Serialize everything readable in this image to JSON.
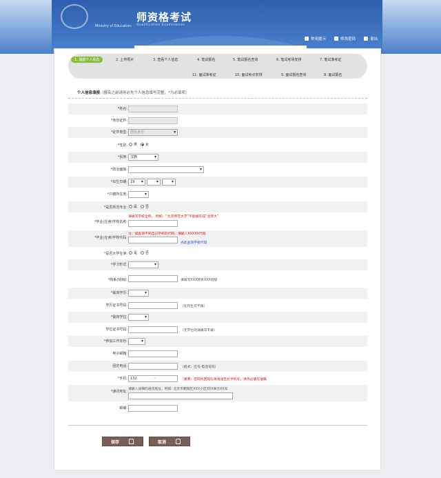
{
  "header": {
    "logo_sub": "Ministry of Education",
    "title": "师资格考试",
    "subtitle": "Qualification Examination",
    "links": [
      "常用提示",
      "修改密码",
      "退出"
    ]
  },
  "steps": [
    "1. 填报个人信息",
    "2. 上传照片",
    "3. 查看个人信息",
    "4. 笔试报名",
    "5. 笔试报名查询",
    "6. 笔试考场安排",
    "7. 笔试准考证",
    "11. 面试准考证",
    "10. 面试考点安排",
    "9. 面试报名查询",
    "8. 面试报名"
  ],
  "section": {
    "title": "个人信息填报",
    "hint": "（报名之前请务必先个人信息填写完整，*为必填项）"
  },
  "form": {
    "name_label": "*姓名:",
    "idno_label": "*身份证件:",
    "idtype_label": "*证件类型:",
    "idtype_value": "居民身份",
    "gender_label": "*性别:",
    "gender_male": "男",
    "gender_female": "女",
    "ethnic_label": "*民族:",
    "ethnic_value": "汉族",
    "political_label": "*政治面貌:",
    "birth_label": "*出生日期:",
    "birth_year": "19",
    "hukou_label": "*户籍所在地:",
    "normal_label": "*是否师范专业:",
    "yes": "是",
    "no": "否",
    "school_label": "*毕业(在读)学校名称:",
    "school_note": "请填写学校全称。 例如：“北京师范大学”不能填写成“北师大”",
    "schoolcode_label": "*毕业(在读)学校代码:",
    "schoolcode_note": "注：如查询不到自己学校的代码，请输入XXXXX代码",
    "schoolcode_link": "点此查询学校代码",
    "student_label": "*是否大学在读:",
    "studyform_label": "*学习形式:",
    "department_label": "*院系(班级):",
    "department_note": "请填写XXX院系XXX班级",
    "degree_label": "*最高学历:",
    "degree_cert_label": "学历证书号码:",
    "degree_cert_note": "（在校生可不填）",
    "academic_label": "*最高学位:",
    "academic_cert_label": "学位证书号码:",
    "academic_cert_note": "（无学位的请填写不填）",
    "workyear_label": "*参加工作年份:",
    "email_label": "电子邮箱:",
    "phone_label": "固定电话:",
    "phone_note": "（格式：区号-电话号码）",
    "mobile_label": "*手机:",
    "mobile_value": "132",
    "mobile_note": "（重要）密码找回短信将发送至此手机号，请务必填写准确",
    "address_label": "*通讯地址:",
    "address_note": "请输入详细的通讯地址，例如: 北京市朝阳区XXX小区XXX单元XX号",
    "zip_label": "邮编:"
  },
  "buttons": {
    "save": "保存",
    "cancel": "取消"
  }
}
